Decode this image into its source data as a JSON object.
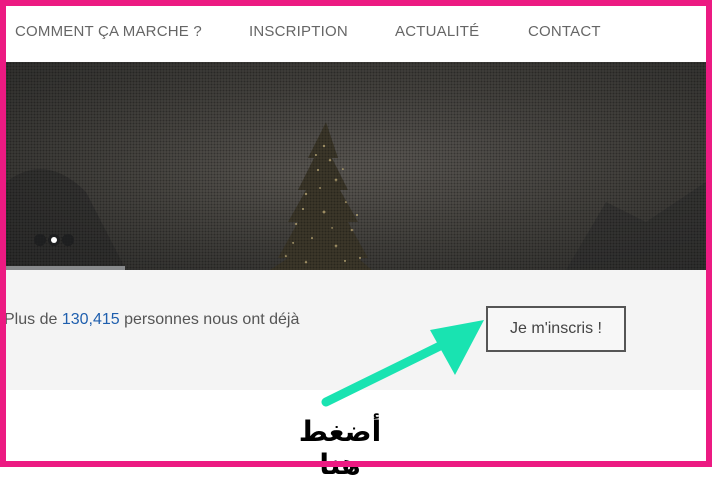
{
  "nav": {
    "items": [
      {
        "label": "COMMENT ÇA MARCHE ?"
      },
      {
        "label": "INSCRIPTION"
      },
      {
        "label": "ACTUALITÉ"
      },
      {
        "label": "CONTACT"
      }
    ]
  },
  "hero": {
    "slides_total": 3,
    "active_slide": 2,
    "slide_progress": 0.17
  },
  "stats": {
    "prefix": "Plus de",
    "count": "130,415",
    "suffix": "personnes nous ont déjà"
  },
  "cta": {
    "label": "Je m'inscris !"
  },
  "annotation": {
    "caption": "أضغط هنا",
    "arrow_color": "#19e3b1",
    "frame_color": "#ec1a82"
  }
}
